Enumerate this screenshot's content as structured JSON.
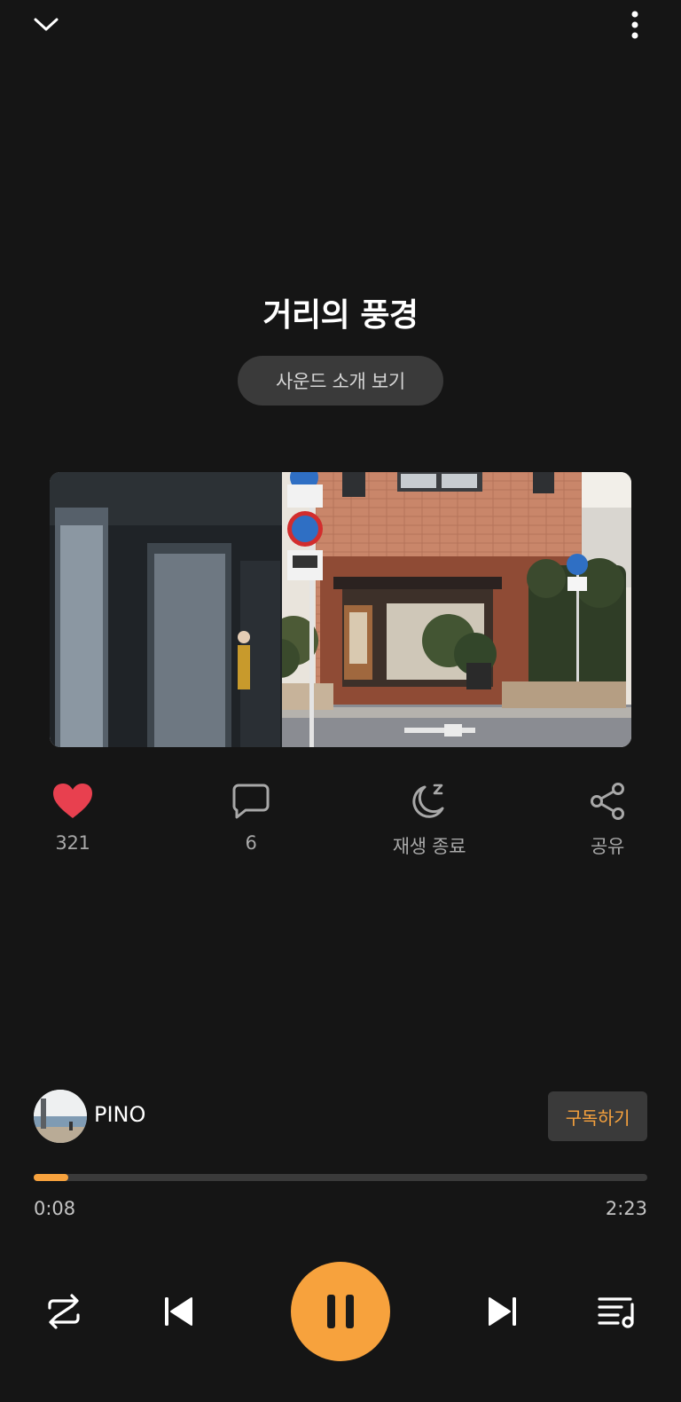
{
  "header": {
    "collapse_icon": "chevron-down-icon",
    "more_icon": "more-vertical-icon"
  },
  "track": {
    "title": "거리의 풍경",
    "intro_button_label": "사운드 소개 보기"
  },
  "actions": {
    "like": {
      "icon": "heart-icon",
      "label": "321",
      "color": "#e8404f"
    },
    "comment": {
      "icon": "comment-icon",
      "label": "6"
    },
    "sleep": {
      "icon": "moon-sleep-icon",
      "label": "재생 종료"
    },
    "share": {
      "icon": "share-icon",
      "label": "공유"
    }
  },
  "artist": {
    "name": "PINO",
    "subscribe_label": "구독하기"
  },
  "player": {
    "current_time": "0:08",
    "total_time": "2:23",
    "progress_fraction": 0.056,
    "accent_color": "#f7a23d"
  },
  "controls": {
    "repeat_icon": "shuffle-repeat-icon",
    "prev_icon": "skip-previous-icon",
    "play_icon": "pause-icon",
    "next_icon": "skip-next-icon",
    "playlist_icon": "playlist-icon"
  }
}
